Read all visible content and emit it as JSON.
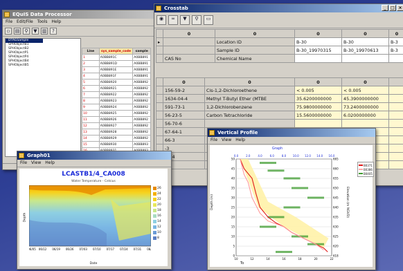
{
  "processor": {
    "title": "EQuIS Data Processor",
    "menu": [
      "File",
      "Edit/File",
      "Tools",
      "Help"
    ],
    "tree_items": [
      "DTAGSample",
      "SPHObjectB1",
      "SPHObjectB2",
      "SPHObjectP1",
      "SPHObjectP4",
      "SPHObjectB4",
      "SPHObjectB5"
    ],
    "table_headers": [
      "Line",
      "sys_sample_code",
      "sample"
    ],
    "table_rows": [
      [
        "1",
        "A0BB891C",
        "A0BB891"
      ],
      [
        "2",
        "A0BB891D",
        "A0BB891"
      ],
      [
        "3",
        "A0BB891E",
        "A0BB891"
      ],
      [
        "4",
        "A0BB891F",
        "A0BB891"
      ],
      [
        "5",
        "A0BB8920",
        "A0BB892"
      ],
      [
        "6",
        "A0BB8921",
        "A0BB892"
      ],
      [
        "7",
        "A0BB8922",
        "A0BB892"
      ],
      [
        "8",
        "A0BB8923",
        "A0BB892"
      ],
      [
        "9",
        "A0BB8924",
        "A0BB892"
      ],
      [
        "10",
        "A0BB8925",
        "A0BB892"
      ],
      [
        "11",
        "A0BB8926",
        "A0BB892"
      ],
      [
        "12",
        "A0BB8927",
        "A0BB892"
      ],
      [
        "13",
        "A0BB8928",
        "A0BB892"
      ],
      [
        "14",
        "A0BB8929",
        "A0BB892"
      ],
      [
        "15",
        "A0BB8930",
        "A0BB893"
      ],
      [
        "16",
        "A0BB8931",
        "A0BB893"
      ],
      [
        "17",
        "A0BB8932",
        "A0BB893"
      ],
      [
        "18",
        "A0BB8933",
        "A0BB893"
      ]
    ]
  },
  "crosstab": {
    "title": "Crosstab",
    "header_row": [
      "",
      "0",
      "0",
      "0",
      "0",
      "0"
    ],
    "meta_rows": [
      {
        "label": "Location ID",
        "values": [
          "B-30",
          "B-30",
          "B-3"
        ]
      },
      {
        "label": "Sample ID",
        "values": [
          "B-30_19970315",
          "B-30_19970613",
          "B-3"
        ]
      },
      {
        "cas": "CAS No",
        "label": "Chemical Name",
        "values": [
          "",
          "",
          ""
        ]
      }
    ],
    "subheader": [
      "0",
      "0",
      "0",
      "0"
    ],
    "rows": [
      {
        "cas": "156-59-2",
        "name": "Cis-1,2-Dichloroethene",
        "v1": "< 0.005",
        "v2": "< 0.005"
      },
      {
        "cas": "1634-04-4",
        "name": "Methyl T-Butyl Ether (MTBE",
        "v1": "35.6200000000",
        "v2": "45.3900000000"
      },
      {
        "cas": "591-73-1",
        "name": "1,2-Dichlorobenzene",
        "v1": "75.9800000000",
        "v2": "73.2400000000"
      },
      {
        "cas": "56-23-5",
        "name": "Carbon Tetrachloride",
        "v1": "15.5600000000",
        "v2": "6.0200000000"
      },
      {
        "cas": "56-70-6",
        "name": "",
        "v1": "",
        "v2": ""
      },
      {
        "cas": "67-64-1",
        "name": "",
        "v1": "",
        "v2": ""
      },
      {
        "cas": "66-3",
        "name": "",
        "v1": "",
        "v2": ""
      },
      {
        "cas": "-3",
        "name": "",
        "v1": "",
        "v2": ""
      },
      {
        "cas": "01-4",
        "name": "",
        "v1": "",
        "v2": ""
      },
      {
        "cas": "-2",
        "name": "",
        "v1": "",
        "v2": ""
      }
    ]
  },
  "graph": {
    "title": "Graph01",
    "menu": [
      "File",
      "View",
      "Help"
    ],
    "chart_title": "LCASTB1/4_CA008",
    "subtitle": "Water Temperature - Celsius",
    "ylabel": "Depth",
    "xlabel": "Date",
    "xticks": [
      "06/05",
      "06/12",
      "06/19",
      "06/26",
      "07/03",
      "07/10",
      "07/17",
      "07/24",
      "07/31",
      "08/07"
    ],
    "legend": [
      "26",
      "24",
      "22",
      "20",
      "18",
      "16",
      "14",
      "12",
      "10",
      "8"
    ],
    "colors": [
      "#e68a00",
      "#f4b000",
      "#f7d21e",
      "#e8e85a",
      "#c9e88a",
      "#a9dcc2",
      "#8ecfe2",
      "#7ab6e4",
      "#6b9bd6",
      "#5c7fc4"
    ]
  },
  "profile": {
    "title": "Vertical Profile",
    "menu": [
      "File",
      "View",
      "Help"
    ],
    "chart_title": "Graph",
    "ylabel": "Depth (m)",
    "y2label": "Elevation (m NGVD)",
    "legend": [
      "B0371",
      "B0386",
      "B0405"
    ],
    "top_ticks": [
      "0.0",
      "2.0",
      "4.0",
      "6.0",
      "8.0",
      "10.0",
      "12.0",
      "14.0",
      "16.0"
    ],
    "bottom_ticks": [
      "10",
      "12",
      "14",
      "16",
      "18",
      "20",
      "22"
    ],
    "bottom_label": "To",
    "yticks": [
      "0",
      "5",
      "10",
      "15",
      "20",
      "25",
      "30",
      "35",
      "40",
      "45",
      "50"
    ],
    "y2ticks": [
      "618",
      "620",
      "625",
      "630",
      "635",
      "640",
      "645",
      "650",
      "655",
      "660",
      "665"
    ],
    "chart_data": {
      "type": "line",
      "y_axis": "Depth (m)",
      "ylim": [
        0,
        50
      ],
      "xlim": [
        10,
        22
      ],
      "series": [
        {
          "name": "B0371",
          "x": [
            10.5,
            11,
            12,
            12.5,
            13,
            14,
            15,
            16,
            17,
            18,
            19,
            20,
            21,
            21.5
          ],
          "y": [
            50,
            45,
            40,
            32,
            25,
            20,
            17,
            15,
            12,
            10,
            8,
            6,
            4,
            2
          ]
        },
        {
          "name": "B0386",
          "x": [
            10.5,
            11,
            11.5,
            12,
            13,
            14,
            16,
            17,
            18,
            20,
            21
          ],
          "y": [
            50,
            42,
            38,
            30,
            22,
            18,
            15,
            12,
            10,
            6,
            3
          ]
        },
        {
          "name": "B0405",
          "x": [
            14,
            15,
            17,
            18,
            20,
            17,
            15,
            14,
            18,
            20,
            16
          ],
          "y": [
            48,
            44,
            40,
            35,
            30,
            25,
            20,
            15,
            10,
            6,
            2
          ]
        }
      ]
    }
  }
}
